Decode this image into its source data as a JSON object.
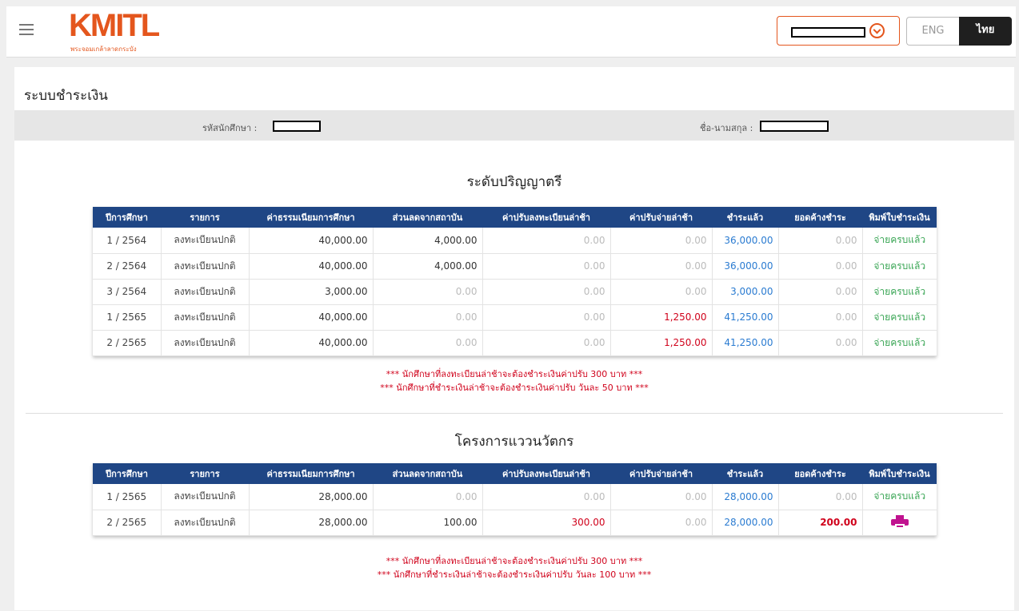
{
  "header": {
    "logo_text": "KMITL",
    "logo_subtitle": "พระจอมเกล้าลาดกระบัง",
    "lang_eng": "ENG",
    "lang_thai": "ไทย"
  },
  "page": {
    "title": "ระบบชำระเงิน",
    "student_id_label": "รหัสนักศึกษา :",
    "student_name_label": "ชื่อ-นามสกุล :"
  },
  "table_headers": [
    "ปีการศึกษา",
    "รายการ",
    "ค่าธรรมเนียมการศึกษา",
    "ส่วนลดจากสถาบัน",
    "ค่าปรับลงทะเบียนล่าช้า",
    "ค่าปรับจ่ายล่าช้า",
    "ชำระแล้ว",
    "ยอดค้างชำระ",
    "พิมพ์ใบชำระเงิน"
  ],
  "sections": [
    {
      "title": "ระดับปริญญาตรี",
      "rows": [
        {
          "term": "1 / 2564",
          "item": "ลงทะเบียนปกติ",
          "tuition": "40,000.00",
          "discount": "4,000.00",
          "late_reg_fine": "0.00",
          "late_pay_fine": "0.00",
          "paid": "36,000.00",
          "outstanding": "0.00",
          "status": "จ่ายครบแล้ว"
        },
        {
          "term": "2 / 2564",
          "item": "ลงทะเบียนปกติ",
          "tuition": "40,000.00",
          "discount": "4,000.00",
          "late_reg_fine": "0.00",
          "late_pay_fine": "0.00",
          "paid": "36,000.00",
          "outstanding": "0.00",
          "status": "จ่ายครบแล้ว"
        },
        {
          "term": "3 / 2564",
          "item": "ลงทะเบียนปกติ",
          "tuition": "3,000.00",
          "discount": "0.00",
          "late_reg_fine": "0.00",
          "late_pay_fine": "0.00",
          "paid": "3,000.00",
          "outstanding": "0.00",
          "status": "จ่ายครบแล้ว"
        },
        {
          "term": "1 / 2565",
          "item": "ลงทะเบียนปกติ",
          "tuition": "40,000.00",
          "discount": "0.00",
          "late_reg_fine": "0.00",
          "late_pay_fine": "1,250.00",
          "paid": "41,250.00",
          "outstanding": "0.00",
          "status": "จ่ายครบแล้ว"
        },
        {
          "term": "2 / 2565",
          "item": "ลงทะเบียนปกติ",
          "tuition": "40,000.00",
          "discount": "0.00",
          "late_reg_fine": "0.00",
          "late_pay_fine": "1,250.00",
          "paid": "41,250.00",
          "outstanding": "0.00",
          "status": "จ่ายครบแล้ว"
        }
      ],
      "notes": [
        "*** นักศึกษาที่ลงทะเบียนล่าช้าจะต้องชำระเงินค่าปรับ 300 บาท ***",
        "*** นักศึกษาที่ชำระเงินล่าช้าจะต้องชำระเงินค่าปรับ วันละ 50 บาท ***"
      ]
    },
    {
      "title": "โครงการแววนวัตกร",
      "rows": [
        {
          "term": "1 / 2565",
          "item": "ลงทะเบียนปกติ",
          "tuition": "28,000.00",
          "discount": "0.00",
          "late_reg_fine": "0.00",
          "late_pay_fine": "0.00",
          "paid": "28,000.00",
          "outstanding": "0.00",
          "status": "จ่ายครบแล้ว"
        },
        {
          "term": "2 / 2565",
          "item": "ลงทะเบียนปกติ",
          "tuition": "28,000.00",
          "discount": "100.00",
          "late_reg_fine": "300.00",
          "late_pay_fine": "0.00",
          "paid": "28,000.00",
          "outstanding": "200.00",
          "status": "print-icon"
        }
      ],
      "notes": [
        "*** นักศึกษาที่ลงทะเบียนล่าช้าจะต้องชำระเงินค่าปรับ 300 บาท ***",
        "*** นักศึกษาที่ชำระเงินล่าช้าจะต้องชำระเงินค่าปรับ วันละ 100 บาท ***"
      ]
    }
  ],
  "colors": {
    "brand": "#e4561d",
    "table_header": "#1f4685",
    "paid": "#2a7bd1",
    "fine": "#d0021b",
    "done": "#3aa655",
    "print": "#c0128f"
  }
}
